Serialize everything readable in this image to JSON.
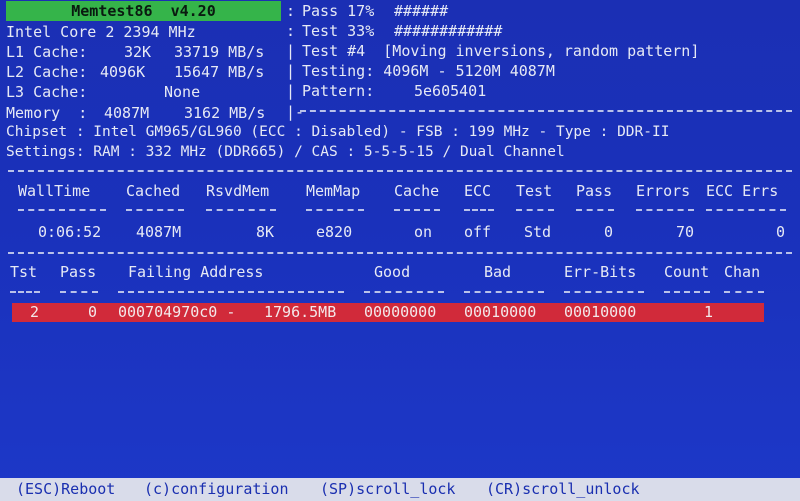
{
  "title": "Memtest86  v4.20",
  "cpu_info": "Intel Core 2 2394 MHz",
  "l1": {
    "label": "L1 Cache:",
    "size": "32K",
    "speed": "33719 MB/s"
  },
  "l2": {
    "label": "L2 Cache:",
    "size": "4096K",
    "speed": "15647 MB/s"
  },
  "l3": {
    "label": "L3 Cache:",
    "size": "None"
  },
  "memory": {
    "label": "Memory  :",
    "size": "4087M",
    "speed": "3162 MB/s"
  },
  "chipset_line": "Chipset : Intel GM965/GL960 (ECC : Disabled) - FSB : 199 MHz - Type : DDR-II",
  "settings_line": "Settings: RAM : 332 MHz (DDR665) / CAS : 5-5-5-15 / Dual Channel",
  "progress": {
    "pass_label": "Pass 17%",
    "pass_bar": "######",
    "test_label": "Test 33%",
    "test_bar": "############",
    "test_num": "Test #4  [Moving inversions, random pattern]",
    "testing": "Testing: 4096M - 5120M 4087M",
    "pattern_label": "Pattern:",
    "pattern_value": "5e605401"
  },
  "stats_headers": [
    "WallTime",
    "Cached",
    "RsvdMem",
    "MemMap",
    "Cache",
    "ECC",
    "Test",
    "Pass",
    "Errors",
    "ECC Errs"
  ],
  "stats_values": [
    "0:06:52",
    "4087M",
    "8K",
    "e820",
    "on",
    "off",
    "Std",
    "0",
    "70",
    "0"
  ],
  "error_headers": [
    "Tst",
    "Pass",
    "Failing Address",
    "Good",
    "Bad",
    "Err-Bits",
    "Count",
    "Chan"
  ],
  "error_row": {
    "tst": "2",
    "pass": "0",
    "address": "000704970c0 -",
    "address_mb": "1796.5MB",
    "good": "00000000",
    "bad": "00010000",
    "err_bits": "00010000",
    "count": "1",
    "chan": ""
  },
  "footer": {
    "reboot": "(ESC)Reboot",
    "config": "(c)configuration",
    "scroll_lock": "(SP)scroll_lock",
    "scroll_unlock": "(CR)scroll_unlock"
  }
}
